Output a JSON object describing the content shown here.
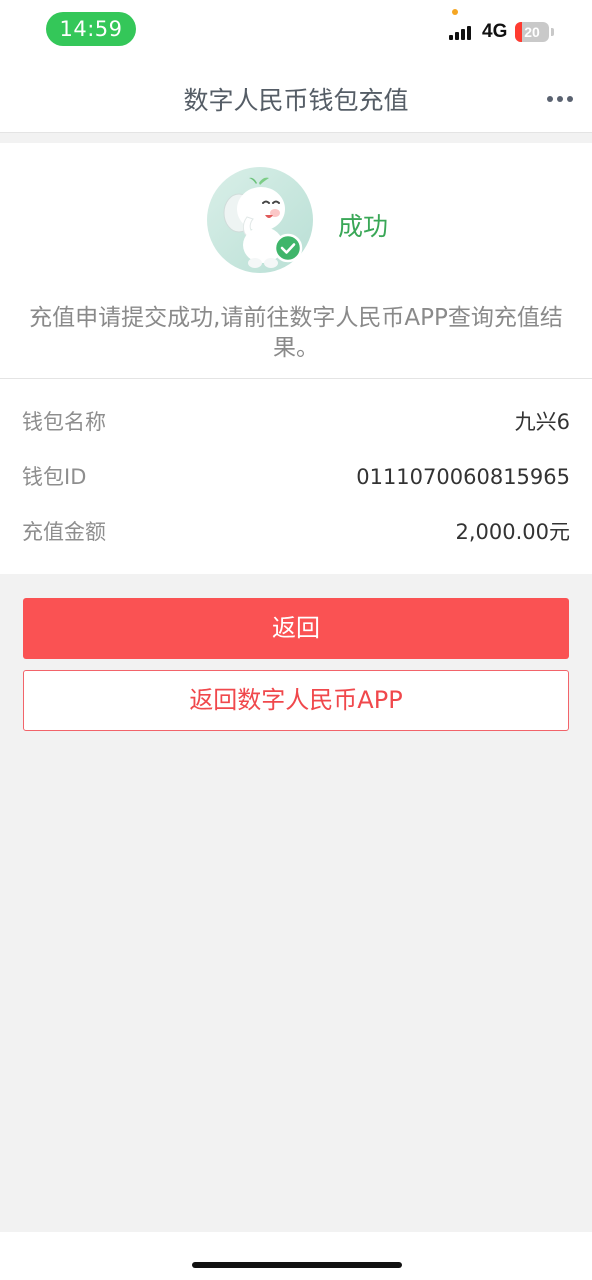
{
  "status_bar": {
    "time": "14:59",
    "network": "4G",
    "battery": "20",
    "battery_level": 0.2,
    "battery_color": "#ff3b30",
    "time_pill_color": "#34c759"
  },
  "nav": {
    "title": "数字人民币钱包充值",
    "more_icon": "more-horizontal-icon"
  },
  "result": {
    "status": "成功",
    "message": "充值申请提交成功,请前往数字人民币APP查询充值结果。",
    "mascot_icon": "elephant-mascot-success-icon",
    "status_color": "#3aa757"
  },
  "details": [
    {
      "label": "钱包名称",
      "value": "九兴6"
    },
    {
      "label": "钱包ID",
      "value": "0111070060815965"
    },
    {
      "label": "充值金额",
      "value": "2,000.00元"
    }
  ],
  "actions": {
    "back_label": "返回",
    "back_to_app_label": "返回数字人民币APP",
    "accent_color": "#fa5253"
  }
}
